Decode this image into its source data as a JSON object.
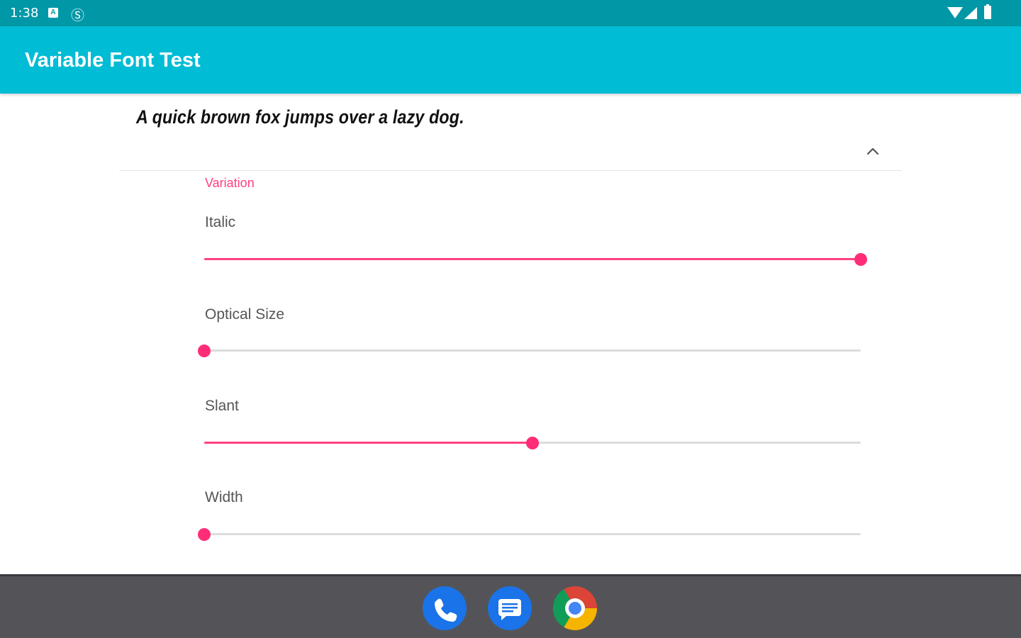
{
  "status_bar": {
    "time": "1:38",
    "left_icons": [
      "a-badge-icon",
      "sync-icon"
    ],
    "right_icons": [
      "wifi-icon",
      "signal-icon",
      "battery-icon"
    ]
  },
  "app_bar": {
    "title": "Variable Font Test",
    "color": "#00bcd4"
  },
  "sample": {
    "text": "A quick brown fox jumps over a lazy dog."
  },
  "variation": {
    "section_label": "Variation",
    "accent_color": "#ff4081",
    "axes": [
      {
        "label": "Italic",
        "fraction": 1.0
      },
      {
        "label": "Optical Size",
        "fraction": 0.0
      },
      {
        "label": "Slant",
        "fraction": 0.5
      },
      {
        "label": "Width",
        "fraction": 0.0
      }
    ]
  },
  "dock": {
    "apps": [
      "phone-app",
      "messages-app",
      "chrome-app"
    ]
  }
}
